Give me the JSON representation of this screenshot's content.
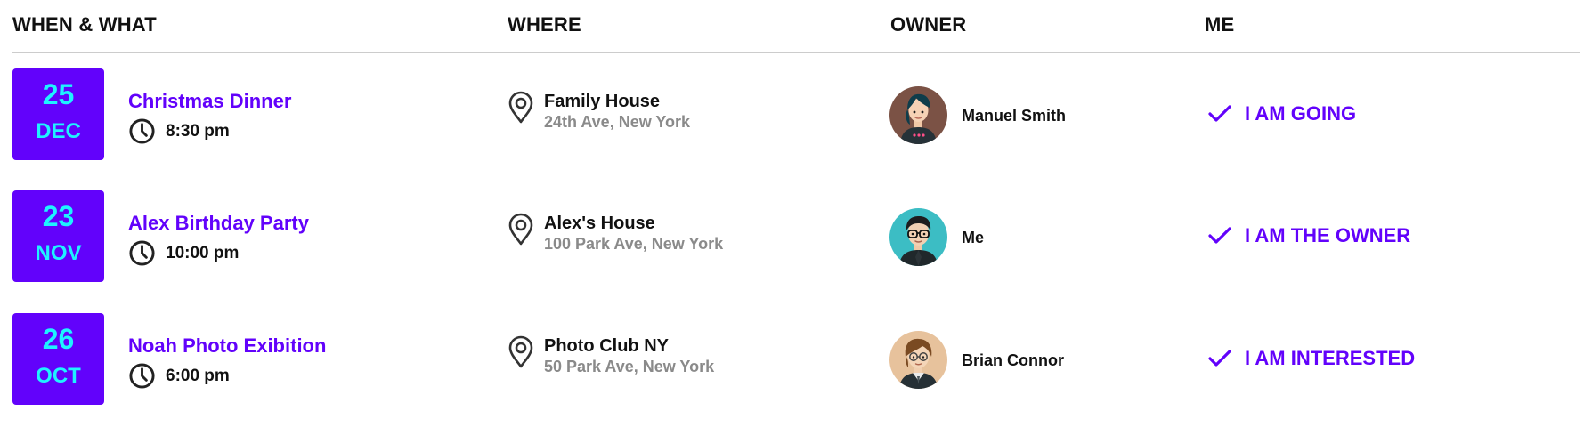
{
  "header": {
    "when_what": "WHEN & WHAT",
    "where": "WHERE",
    "owner": "OWNER",
    "me": "ME"
  },
  "events": [
    {
      "day": "25",
      "month": "DEC",
      "title": "Christmas Dinner",
      "time": "8:30 pm",
      "place_name": "Family House",
      "place_address": "24th Ave, New York",
      "owner": "Manuel Smith",
      "owner_avatar": "woman-avatar",
      "status": "I AM GOING"
    },
    {
      "day": "23",
      "month": "NOV",
      "title": "Alex Birthday Party",
      "time": "10:00 pm",
      "place_name": "Alex's House",
      "place_address": "100 Park Ave, New York",
      "owner": "Me",
      "owner_avatar": "man-glasses-avatar",
      "status": "I AM THE OWNER"
    },
    {
      "day": "26",
      "month": "OCT",
      "title": "Noah Photo Exibition",
      "time": "6:00 pm",
      "place_name": "Photo Club NY",
      "place_address": "50 Park Ave, New York",
      "owner": "Brian Connor",
      "owner_avatar": "man-brown-hair-avatar",
      "status": "I AM INTERESTED"
    }
  ],
  "colors": {
    "accent": "#6202fb",
    "date_text": "#1ef3ff",
    "address_gray": "#8a8a8a",
    "divider": "#cccccc"
  },
  "icons": {
    "time": "clock-icon",
    "location": "map-pin-icon",
    "status": "checkmark-icon"
  }
}
